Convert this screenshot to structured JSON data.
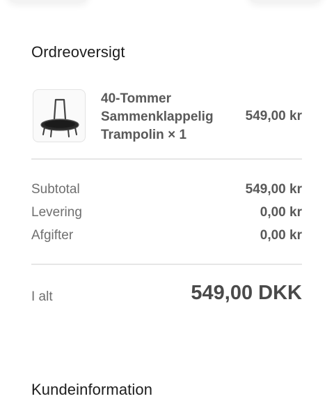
{
  "order_summary": {
    "title": "Ordreoversigt",
    "product": {
      "name_lines": [
        "40-Tommer",
        "Sammenklappelig",
        "Trampolin × 1"
      ],
      "price": "549,00 kr",
      "image_icon": "trampoline-image"
    },
    "subtotal": {
      "label": "Subtotal",
      "value": "549,00 kr"
    },
    "delivery": {
      "label": "Levering",
      "value": "0,00 kr"
    },
    "taxes": {
      "label": "Afgifter",
      "value": "0,00 kr"
    },
    "total": {
      "label": "I alt",
      "value": "549,00 DKK"
    }
  },
  "customer_info": {
    "title": "Kundeinformation"
  }
}
